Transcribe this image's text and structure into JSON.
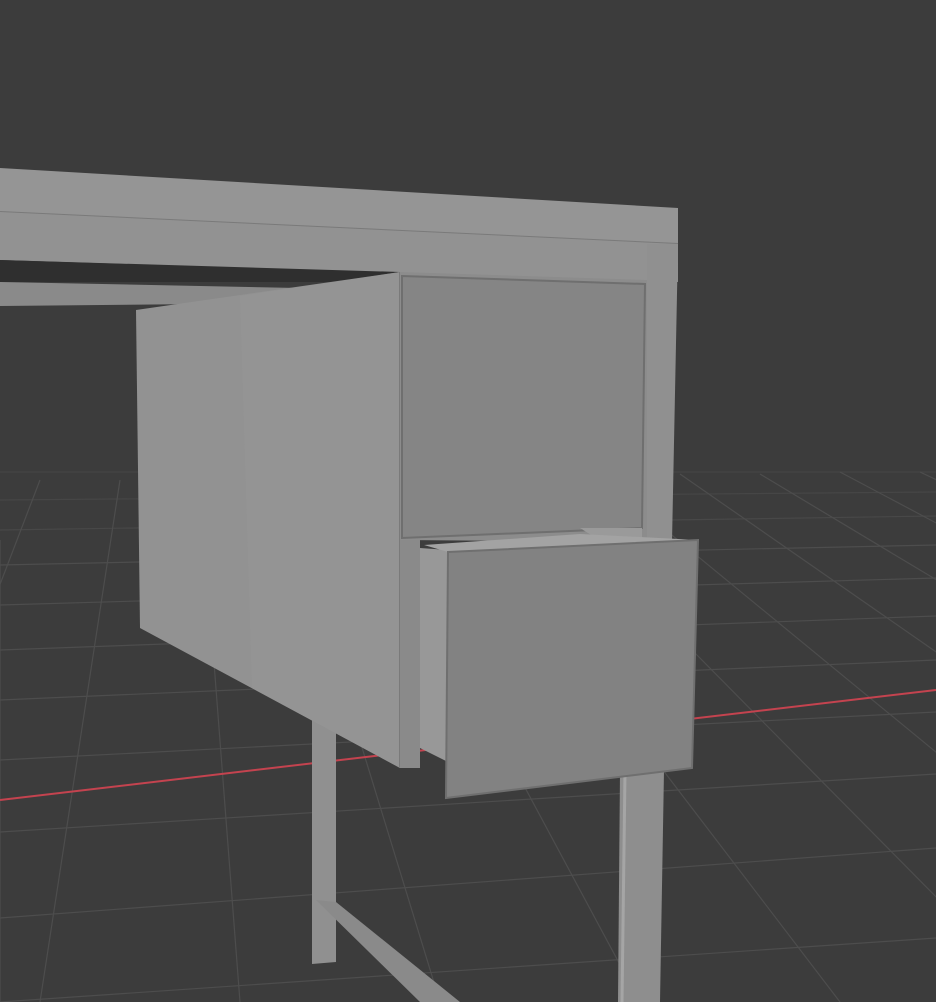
{
  "viewport": {
    "mode": "solid-shading",
    "scene_object": "desk-with-drawers",
    "colors": {
      "background": "#3c3c3c",
      "grid_line": "#4d4d4d",
      "x_axis": "#c4434f",
      "surface_light": "#999999",
      "surface_mid": "#8f8f8f",
      "surface_dark": "#828282",
      "edge": "#6f6f6f"
    },
    "drawers": {
      "top": {
        "state": "closed"
      },
      "bottom": {
        "state": "open"
      }
    }
  }
}
